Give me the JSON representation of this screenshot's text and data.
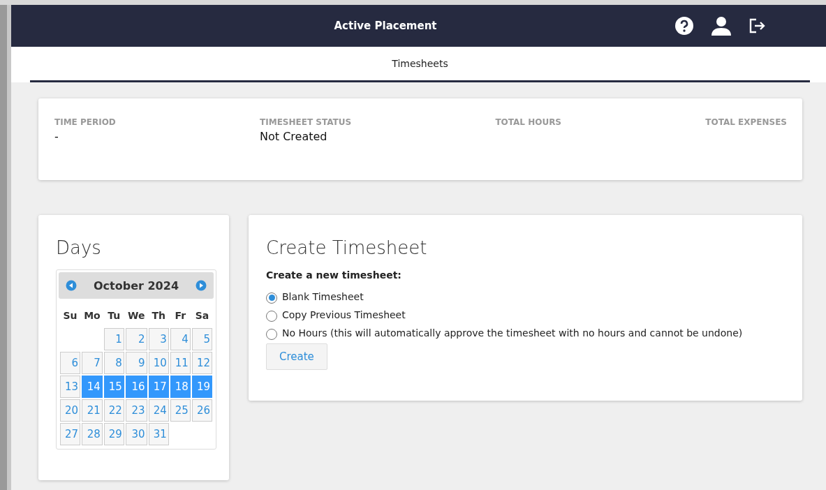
{
  "header": {
    "title": "Active Placement"
  },
  "tabs": [
    {
      "label": "Timesheets",
      "selected": true
    }
  ],
  "summary": [
    {
      "label": "TIME PERIOD",
      "value": "-"
    },
    {
      "label": "TIMESHEET STATUS",
      "value": "Not Created"
    },
    {
      "label": "TOTAL HOURS"
    },
    {
      "label": "TOTAL EXPENSES"
    }
  ],
  "days": {
    "title": "Days",
    "calendar": {
      "month": "October 2024",
      "weekdays": [
        "Su",
        "Mo",
        "Tu",
        "We",
        "Th",
        "Fr",
        "Sa"
      ],
      "weeks": [
        [
          {
            "day": "1",
            "selected": false
          },
          {
            "day": "2",
            "selected": false
          },
          {
            "day": "3",
            "selected": false
          },
          {
            "day": "4",
            "selected": false
          },
          {
            "day": "5",
            "selected": false
          }
        ],
        [
          {
            "day": "6",
            "selected": false
          },
          {
            "day": "7",
            "selected": false
          },
          {
            "day": "8",
            "selected": false
          },
          {
            "day": "9",
            "selected": false
          },
          {
            "day": "10",
            "selected": false
          },
          {
            "day": "11",
            "selected": false
          },
          {
            "day": "12",
            "selected": false
          }
        ],
        [
          {
            "day": "13",
            "selected": false
          },
          {
            "day": "14",
            "selected": true
          },
          {
            "day": "15",
            "selected": true
          },
          {
            "day": "16",
            "selected": true
          },
          {
            "day": "17",
            "selected": true
          },
          {
            "day": "18",
            "selected": true
          },
          {
            "day": "19",
            "selected": true
          }
        ],
        [
          {
            "day": "20",
            "selected": false
          },
          {
            "day": "21",
            "selected": false
          },
          {
            "day": "22",
            "selected": false
          },
          {
            "day": "23",
            "selected": false
          },
          {
            "day": "24",
            "selected": false
          },
          {
            "day": "25",
            "selected": false
          },
          {
            "day": "26",
            "selected": false
          }
        ],
        [
          {
            "day": "27",
            "selected": false
          },
          {
            "day": "28",
            "selected": false
          },
          {
            "day": "29",
            "selected": false
          },
          {
            "day": "30",
            "selected": false
          },
          {
            "day": "31",
            "selected": false
          }
        ]
      ]
    }
  },
  "create": {
    "title": "Create Timesheet",
    "prompt": "Create a new timesheet:",
    "options": [
      {
        "label": "Blank Timesheet",
        "selected": true
      },
      {
        "label": "Copy Previous Timesheet",
        "selected": false
      },
      {
        "label": "No Hours (this will automatically approve the timesheet with no hours and cannot be undone)",
        "selected": false
      }
    ],
    "button": "Create"
  }
}
